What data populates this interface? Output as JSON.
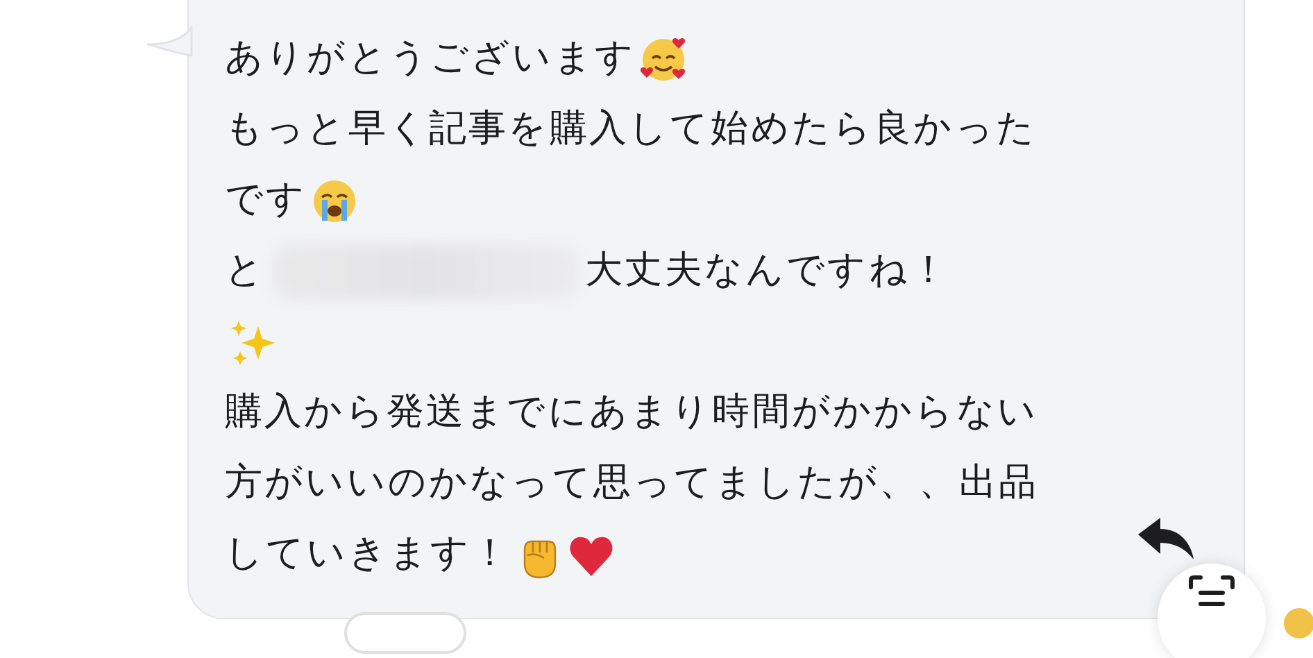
{
  "message": {
    "lines": [
      {
        "parts": [
          {
            "kind": "text",
            "text": "ありがとうございます"
          },
          {
            "kind": "hearts"
          }
        ]
      },
      {
        "parts": [
          {
            "kind": "text",
            "text": "もっと早く記事を購入して始めたら良かった"
          }
        ]
      },
      {
        "parts": [
          {
            "kind": "text",
            "text": "です"
          },
          {
            "kind": "crying"
          }
        ]
      },
      {
        "parts": [
          {
            "kind": "text",
            "text": "と"
          },
          {
            "kind": "blur"
          },
          {
            "kind": "text",
            "text": "大丈夫なんですね！"
          }
        ]
      },
      {
        "parts": [
          {
            "kind": "sparkles"
          }
        ]
      },
      {
        "parts": [
          {
            "kind": "text",
            "text": "購入から発送までにあまり時間がかからない"
          }
        ]
      },
      {
        "parts": [
          {
            "kind": "text",
            "text": "方がいいのかなって思ってましたが、、出品"
          }
        ]
      },
      {
        "parts": [
          {
            "kind": "text",
            "text": "していきます！"
          },
          {
            "kind": "fist"
          },
          {
            "kind": "heart"
          }
        ]
      }
    ]
  }
}
